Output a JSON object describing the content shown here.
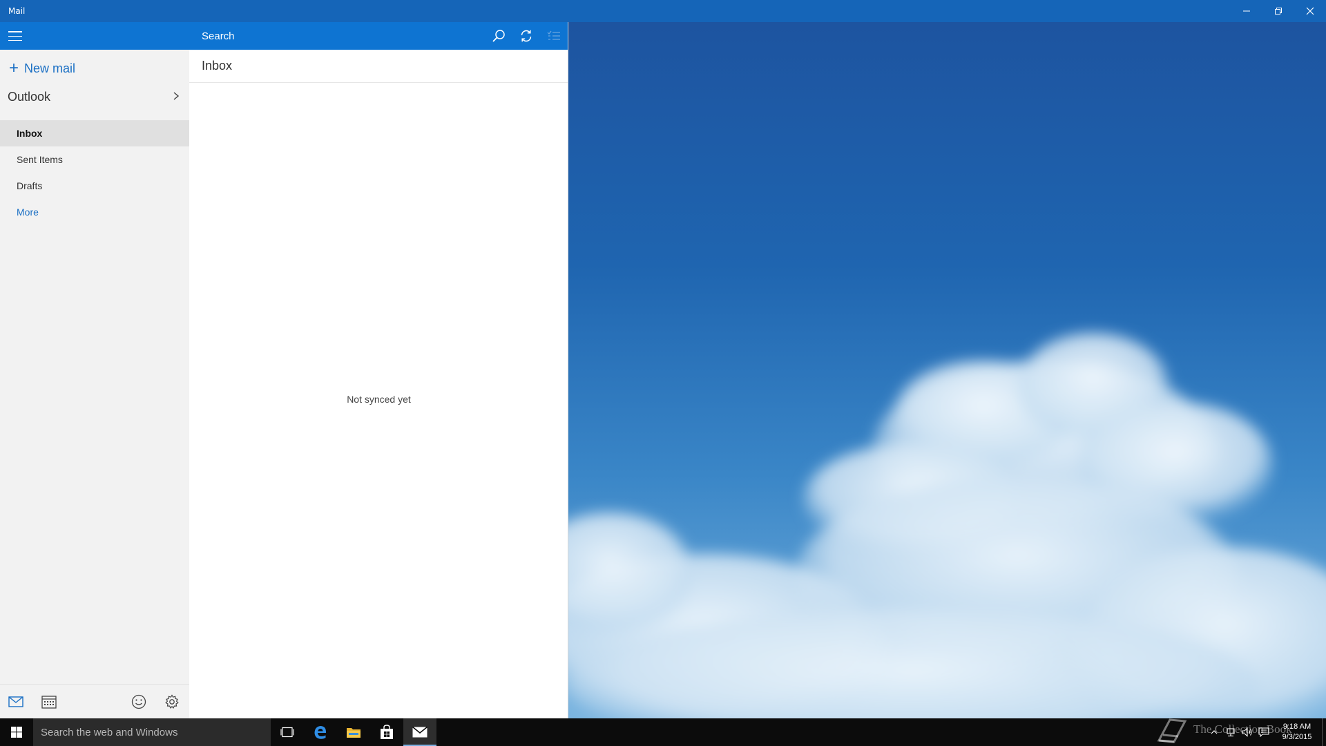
{
  "window": {
    "title": "Mail"
  },
  "nav": {
    "new_mail_label": "New mail",
    "account_name": "Outlook",
    "folders": [
      {
        "label": "Inbox",
        "selected": true
      },
      {
        "label": "Sent Items",
        "selected": false
      },
      {
        "label": "Drafts",
        "selected": false
      }
    ],
    "more_label": "More"
  },
  "list": {
    "search_placeholder": "Search",
    "folder_title": "Inbox",
    "empty_message": "Not synced yet"
  },
  "taskbar": {
    "search_placeholder": "Search the web and Windows",
    "watermark_text": "The Collection Book",
    "clock_time": "9:18 AM",
    "clock_date": "9/3/2015"
  },
  "colors": {
    "title_bar": "#1565b8",
    "accent": "#0e74d2",
    "link": "#1a6fc4",
    "nav_bg": "#f2f2f2",
    "selected_folder_bg": "#e0e0e0",
    "taskbar": "#0c0c0c"
  }
}
